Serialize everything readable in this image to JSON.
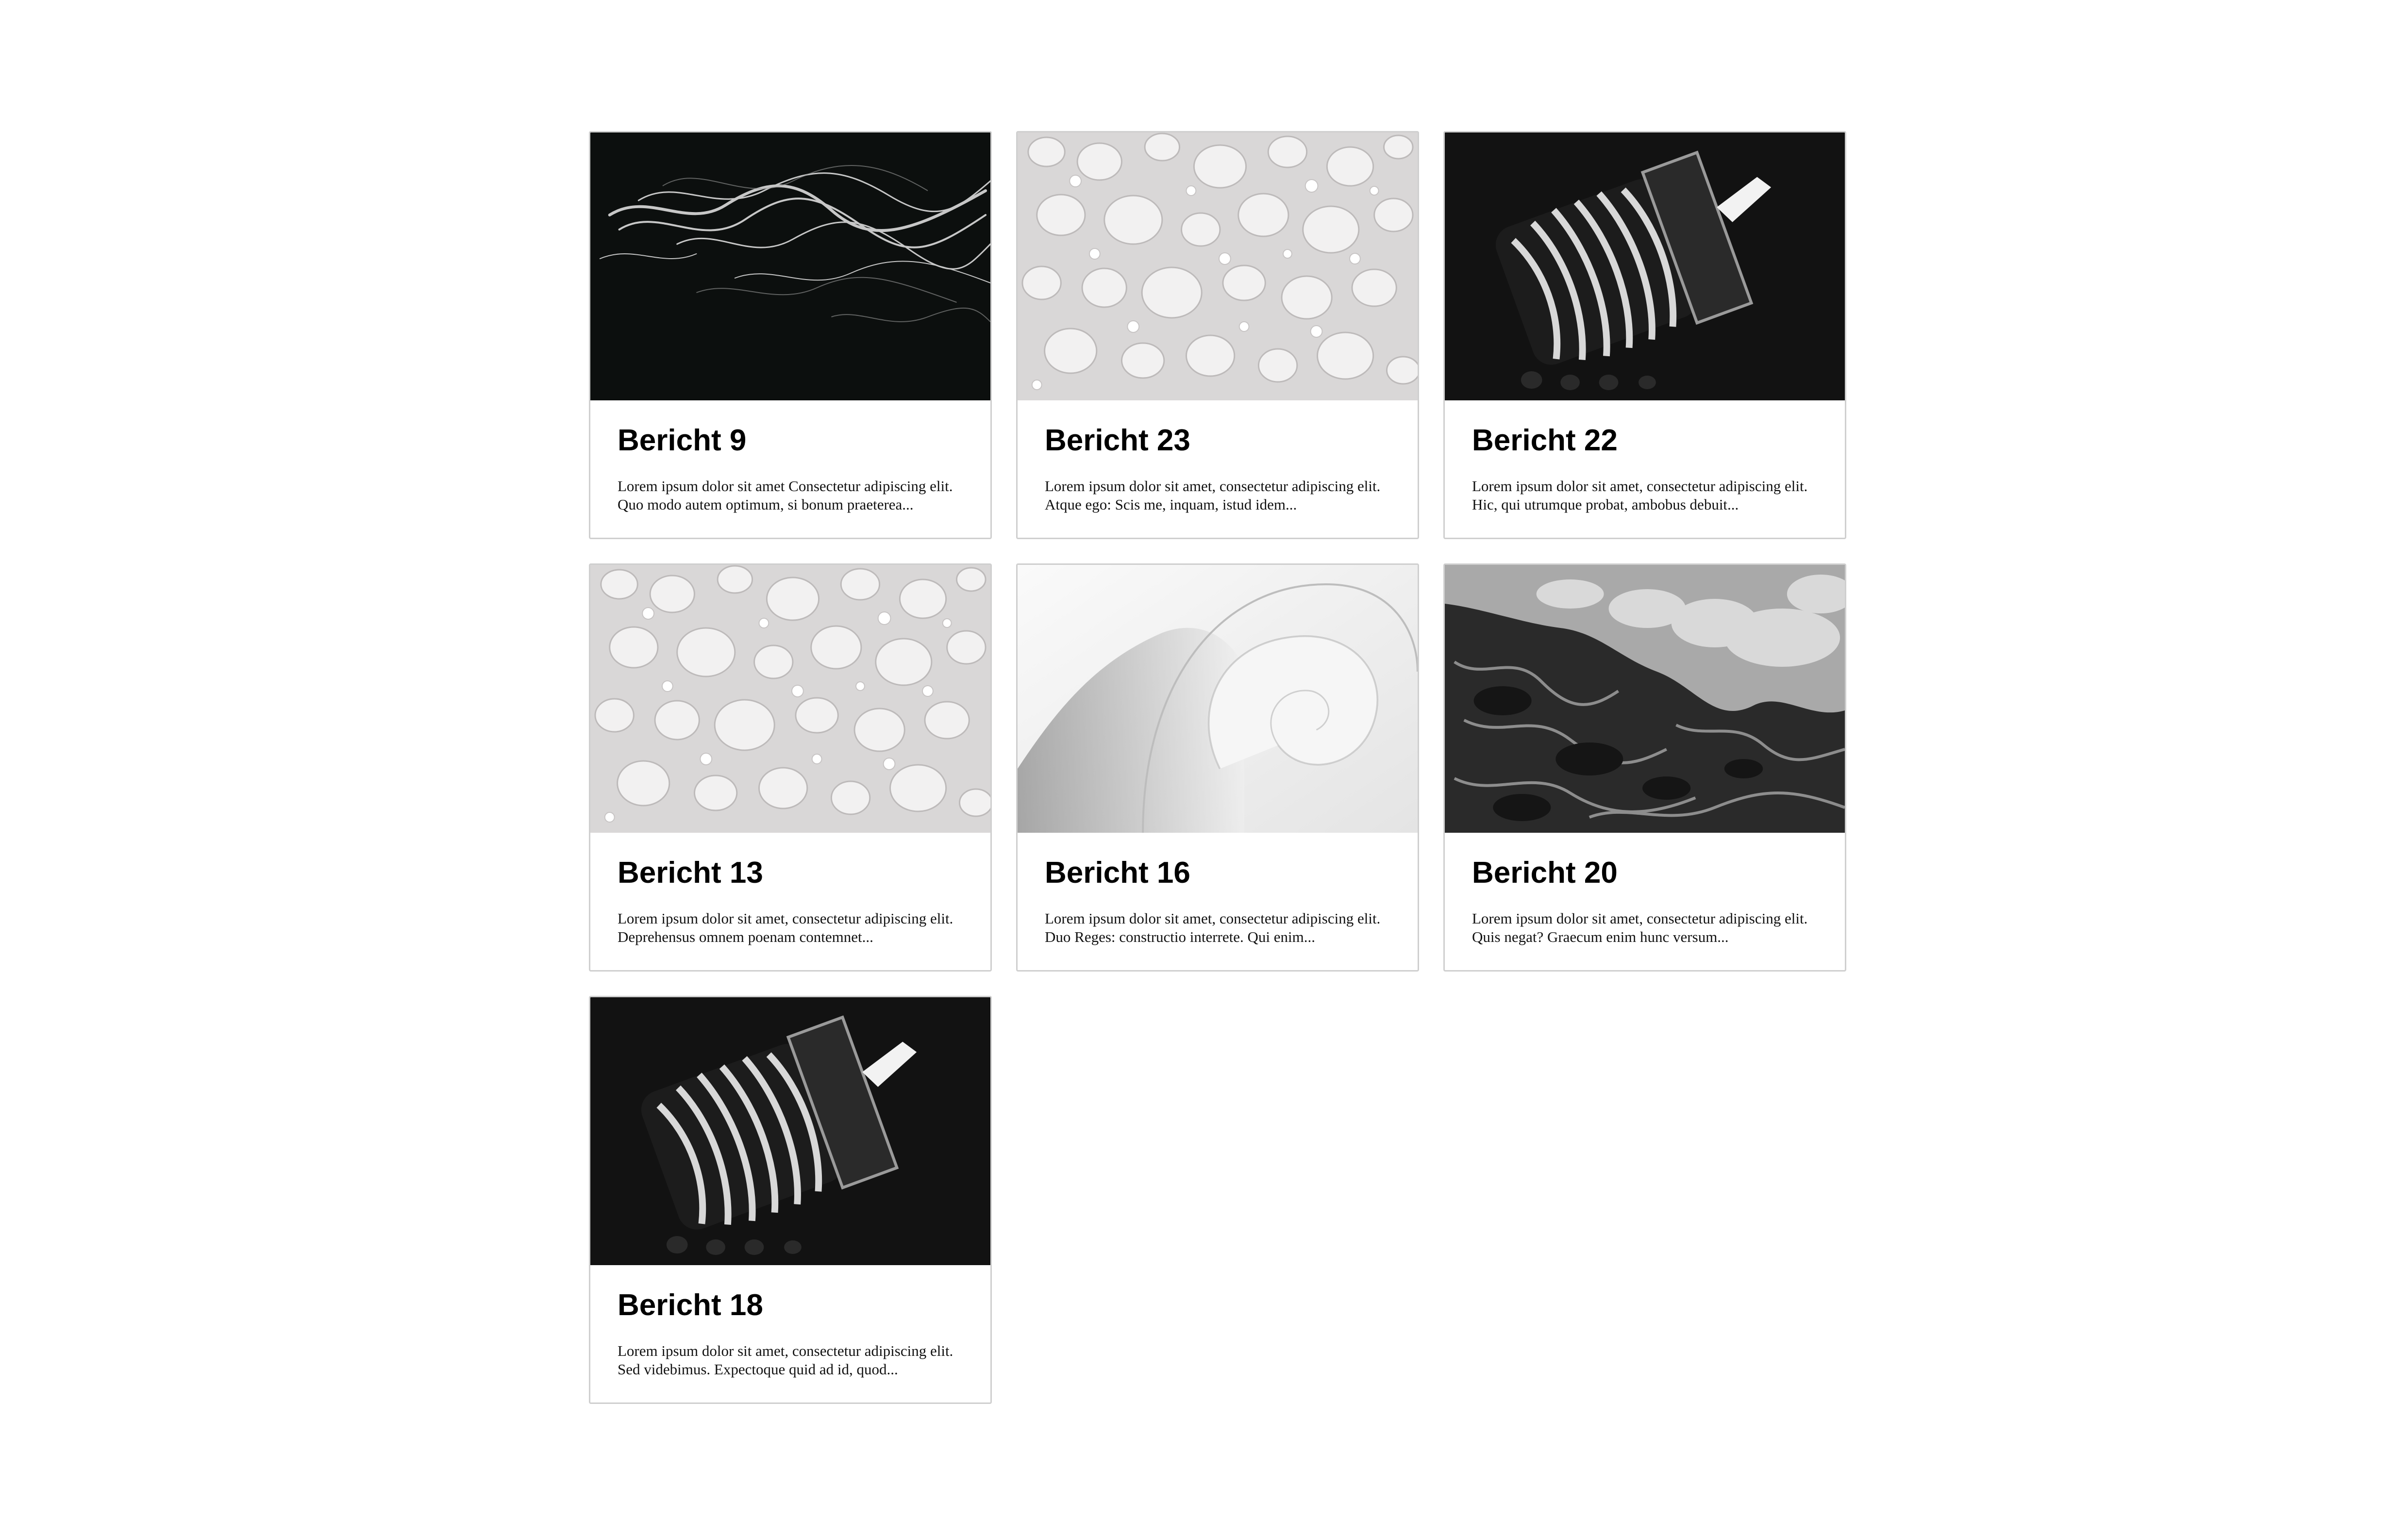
{
  "posts": [
    {
      "title": "Bericht 9",
      "image": "smoke-image",
      "excerpt": "Lorem ipsum dolor sit amet Consectetur adipiscing elit. Quo modo autem optimum, si bonum praeterea..."
    },
    {
      "title": "Bericht 23",
      "image": "water-drops-image",
      "excerpt": "Lorem ipsum dolor sit amet, consectetur adipiscing elit. Atque ego: Scis me, inquam, istud idem..."
    },
    {
      "title": "Bericht 22",
      "image": "light-bulb-image",
      "excerpt": "Lorem ipsum dolor sit amet, consectetur adipiscing elit. Hic, qui utrumque probat, ambobus debuit..."
    },
    {
      "title": "Bericht 13",
      "image": "water-drops-image",
      "excerpt": "Lorem ipsum dolor sit amet, consectetur adipiscing elit. Deprehensus omnem poenam contemnet..."
    },
    {
      "title": "Bericht 16",
      "image": "paper-curl-image",
      "excerpt": "Lorem ipsum dolor sit amet, consectetur adipiscing elit. Duo Reges: constructio interrete. Qui enim..."
    },
    {
      "title": "Bericht 20",
      "image": "ocean-wave-image",
      "excerpt": "Lorem ipsum dolor sit amet, consectetur adipiscing elit. Quis negat? Graecum enim hunc versum..."
    },
    {
      "title": "Bericht 18",
      "image": "light-bulb-image",
      "excerpt": "Lorem ipsum dolor sit amet, consectetur adipiscing elit. Sed videbimus. Expectoque quid ad id, quod..."
    }
  ]
}
